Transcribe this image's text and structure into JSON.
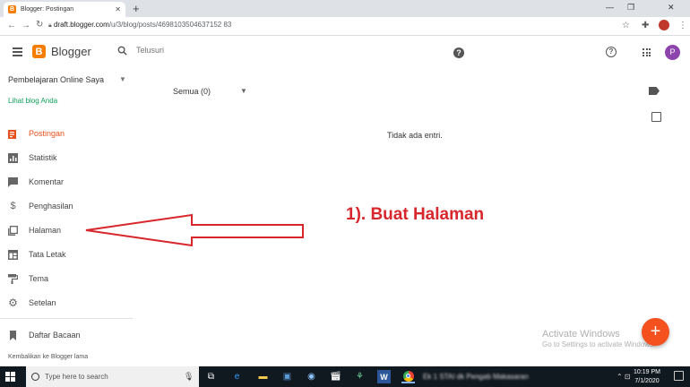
{
  "browser": {
    "tab_title": "Blogger: Postingan",
    "tab_favicon": "B",
    "url_host": "draft.blogger.com",
    "url_path": "/u/3/blog/posts/4698103504637152 83"
  },
  "header": {
    "logo_letter": "B",
    "app_name": "Blogger",
    "search_placeholder": "Telusuri",
    "help_icon": "?",
    "avatar_letter": "P",
    "accent_color": "#f57d00"
  },
  "sidebar": {
    "blog_name": "Pembelajaran Online Saya",
    "view_blog": "Lihat blog Anda",
    "items": [
      {
        "label": "Postingan",
        "icon": "posts-icon",
        "active": true
      },
      {
        "label": "Statistik",
        "icon": "stats-icon",
        "active": false
      },
      {
        "label": "Komentar",
        "icon": "comment-icon",
        "active": false
      },
      {
        "label": "Penghasilan",
        "icon": "dollar-icon",
        "active": false
      },
      {
        "label": "Halaman",
        "icon": "pages-icon",
        "active": false
      },
      {
        "label": "Tata Letak",
        "icon": "layout-icon",
        "active": false
      },
      {
        "label": "Tema",
        "icon": "theme-icon",
        "active": false
      },
      {
        "label": "Setelan",
        "icon": "gear-icon",
        "active": false
      }
    ],
    "reading_list": "Daftar Bacaan",
    "old_blogger": "Kembalikan ke Blogger lama"
  },
  "main": {
    "filter_label": "Semua (0)",
    "empty_message": "Tidak ada entri.",
    "annotation": "1). Buat Halaman",
    "annotation_color": "#d7262c",
    "fab_label": "+"
  },
  "watermark": {
    "title": "Activate Windows",
    "subtitle": "Go to Settings to activate Windows."
  },
  "taskbar": {
    "search_placeholder": "Type here to search",
    "blurred_window": "Ek 1 STAI dk Pengab Makasaran",
    "time": "10:19 PM",
    "date": "7/1/2020"
  }
}
